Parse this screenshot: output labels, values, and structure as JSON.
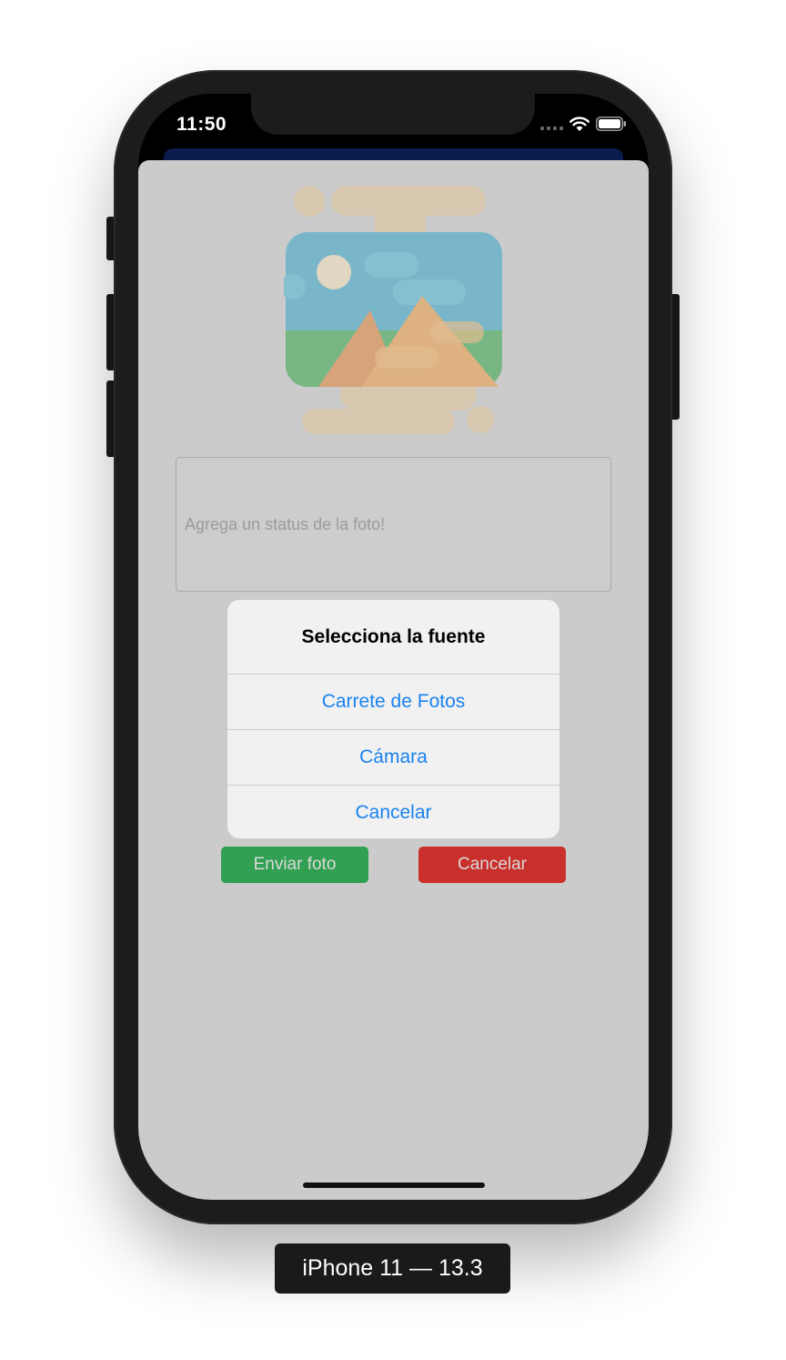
{
  "status_bar": {
    "time": "11:50"
  },
  "sheet": {
    "status_placeholder": "Agrega un status de la foto!",
    "send_button": "Enviar foto",
    "cancel_button": "Cancelar"
  },
  "alert": {
    "title": "Selecciona la fuente",
    "actions": [
      "Carrete de Fotos",
      "Cámara",
      "Cancelar"
    ],
    "action_color": "#1a82f0"
  },
  "colors": {
    "send": "#31a052",
    "cancel": "#c9302c",
    "nav": "#0b1d4f"
  },
  "icons": [
    "wifi-icon",
    "battery-icon",
    "signal-icon",
    "image-placeholder-icon"
  ],
  "device_label": "iPhone 11 — 13.3"
}
